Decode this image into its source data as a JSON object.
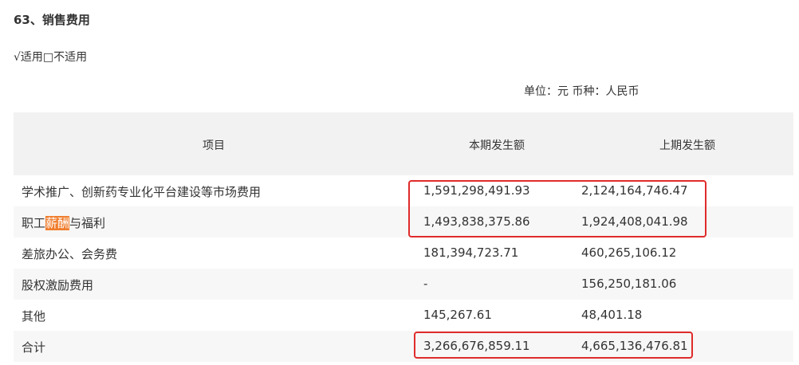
{
  "section_title": "63、销售费用",
  "applicable": "√适用□不适用",
  "unit_line": "单位：元 币种：人民币",
  "table": {
    "headers": {
      "item": "项目",
      "current": "本期发生额",
      "previous": "上期发生额"
    },
    "rows": [
      {
        "item": "学术推广、创新药专业化平台建设等市场费用",
        "current": "1,591,298,491.93",
        "previous": "2,124,164,746.47"
      },
      {
        "item_pre": "职工",
        "item_hl": "薪酬",
        "item_post": "与福利",
        "current": "1,493,838,375.86",
        "previous": "1,924,408,041.98"
      },
      {
        "item": "差旅办公、会务费",
        "current": "181,394,723.71",
        "previous": "460,265,106.12"
      },
      {
        "item": "股权激励费用",
        "current": "-",
        "previous": "156,250,181.06"
      },
      {
        "item": "其他",
        "current": "145,267.61",
        "previous": "48,401.18"
      },
      {
        "item": "合计",
        "current": "3,266,676,859.11",
        "previous": "4,665,136,476.81"
      }
    ]
  },
  "colors": {
    "highlight_box": "#e02b2b",
    "search_highlight": "#f07c2c",
    "header_bg": "#f2f2f2"
  }
}
